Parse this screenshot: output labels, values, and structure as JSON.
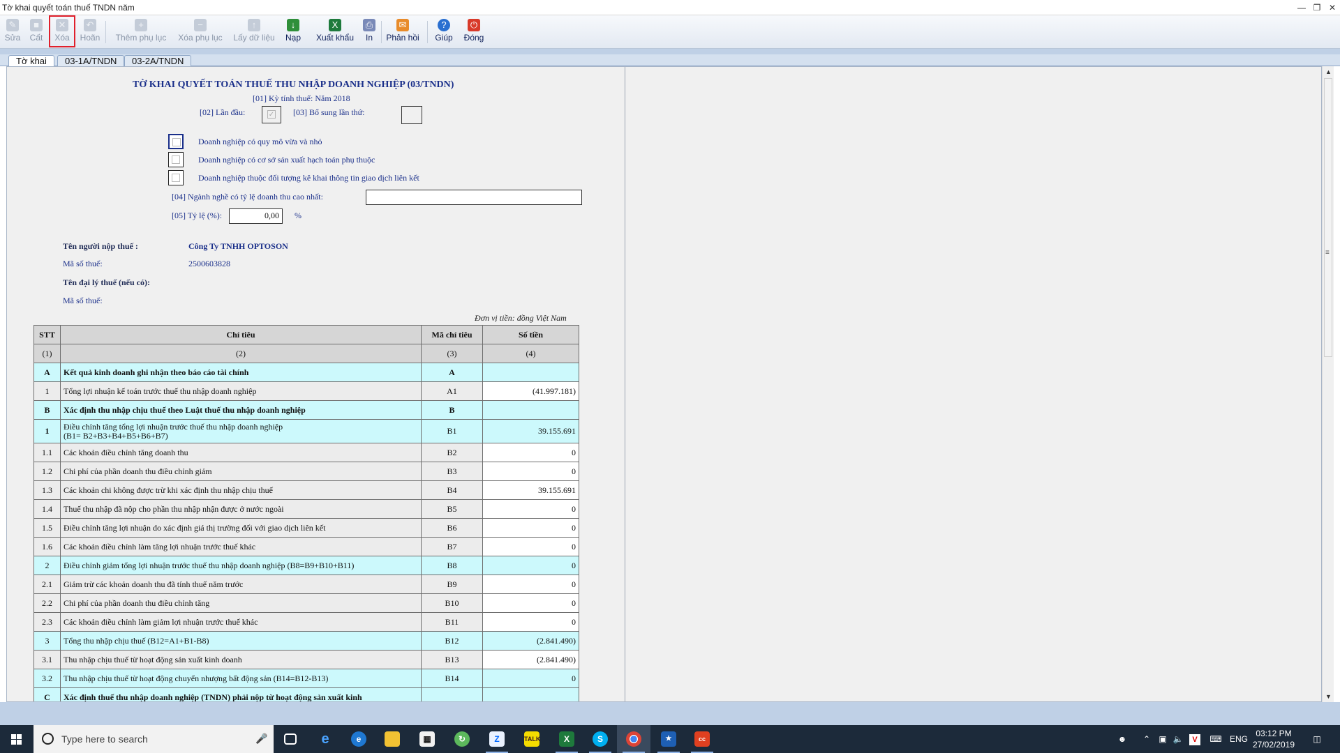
{
  "window": {
    "title": "Tờ khai quyết toán thuế TNDN năm"
  },
  "toolbar": {
    "sua": "Sửa",
    "cat": "Cất",
    "xoa": "Xóa",
    "hoan": "Hoãn",
    "them_phu_luc": "Thêm phụ lục",
    "xoa_phu_luc": "Xóa phụ lục",
    "lay_du_lieu": "Lấy dữ liệu",
    "nap": "Nạp",
    "xuat_khau": "Xuất khẩu",
    "in": "In",
    "phan_hoi": "Phản hồi",
    "giup": "Giúp",
    "dong": "Đóng"
  },
  "tabs": {
    "to_khai": "Tờ khai",
    "pl_1a": "03-1A/TNDN",
    "pl_2a": "03-2A/TNDN"
  },
  "form": {
    "title": "TỜ KHAI QUYẾT TOÁN THUẾ THU NHẬP DOANH NGHIỆP (03/TNDN)",
    "ky_tinh_thue": "[01] Kỳ tính thuế: Năm 2018",
    "lan_dau": "[02] Lần đầu:",
    "bo_sung": "[03] Bổ sung lần thứ:",
    "check_sme": "Doanh nghiệp có quy mô vừa và nhỏ",
    "check_phu_thuoc": "Doanh nghiệp có cơ sở sản xuất hạch toán phụ thuộc",
    "check_lien_ket": "Doanh nghiệp thuộc đối tượng kê khai thông tin giao dịch liên kết",
    "nganh_nghe": "[04] Ngành nghề có tỷ lệ doanh thu cao nhất:",
    "ty_le_label": "[05] Tỷ lệ (%):",
    "ty_le_value": "0,00",
    "percent": "%",
    "ten_nnt_label": "Tên người nộp thuế :",
    "ten_nnt": "Công Ty TNHH OPTOSON",
    "mst_label": "Mã số thuế:",
    "mst": "2500603828",
    "dai_ly_label": "Tên đại lý thuế (nếu có):",
    "mst_dl_label": "Mã số thuế:",
    "don_vi": "Đơn vị tiền: đồng Việt Nam"
  },
  "table": {
    "headers": {
      "stt": "STT",
      "chi_tieu": "Chỉ tiêu",
      "ma": "Mã chỉ tiêu",
      "so_tien": "Số tiền"
    },
    "subheaders": {
      "c1": "(1)",
      "c2": "(2)",
      "c3": "(3)",
      "c4": "(4)"
    },
    "rows": [
      {
        "stt": "A",
        "label": "Kết quả kinh doanh ghi nhận theo báo cáo tài chính",
        "code": "A",
        "value": ""
      },
      {
        "stt": "1",
        "label": "Tổng lợi nhuận kế toán trước thuế thu nhập doanh nghiệp",
        "code": "A1",
        "value": "(41.997.181)"
      },
      {
        "stt": "B",
        "label": "Xác định thu nhập chịu thuế theo Luật thuế thu nhập doanh nghiệp",
        "code": "B",
        "value": ""
      },
      {
        "stt": "1",
        "label": "Điều chỉnh tăng tổng lợi nhuận trước thuế thu nhập doanh nghiệp",
        "label2": "(B1= B2+B3+B4+B5+B6+B7)",
        "code": "B1",
        "value": "39.155.691"
      },
      {
        "stt": "1.1",
        "label": "Các khoản điều chỉnh tăng doanh thu",
        "code": "B2",
        "value": "0"
      },
      {
        "stt": "1.2",
        "label": "Chi phí của phần doanh thu điều chỉnh giảm",
        "code": "B3",
        "value": "0"
      },
      {
        "stt": "1.3",
        "label": "Các khoản chi không được trừ khi xác định thu nhập chịu thuế",
        "code": "B4",
        "value": "39.155.691"
      },
      {
        "stt": "1.4",
        "label": "Thuế thu nhập đã nộp cho phần thu nhập nhận được ở nước ngoài",
        "code": "B5",
        "value": "0"
      },
      {
        "stt": "1.5",
        "label": "Điều chỉnh tăng lợi nhuận do xác định giá thị trường đối với giao dịch liên kết",
        "code": "B6",
        "value": "0"
      },
      {
        "stt": "1.6",
        "label": "Các khoản điều chỉnh làm tăng lợi nhuận trước thuế khác",
        "code": "B7",
        "value": "0"
      },
      {
        "stt": "2",
        "label": "Điều chỉnh giảm tổng lợi nhuận trước thuế thu nhập doanh nghiệp (B8=B9+B10+B11)",
        "code": "B8",
        "value": "0"
      },
      {
        "stt": "2.1",
        "label": "Giảm trừ các khoản doanh thu đã tính thuế năm trước",
        "code": "B9",
        "value": "0"
      },
      {
        "stt": "2.2",
        "label": "Chi phí của phần doanh thu điều chỉnh tăng",
        "code": "B10",
        "value": "0"
      },
      {
        "stt": "2.3",
        "label": "Các khoản điều chỉnh làm giảm lợi nhuận trước thuế khác",
        "code": "B11",
        "value": "0"
      },
      {
        "stt": "3",
        "label": "Tổng thu nhập chịu thuế (B12=A1+B1-B8)",
        "code": "B12",
        "value": "(2.841.490)"
      },
      {
        "stt": "3.1",
        "label": "Thu nhập chịu thuế từ hoạt động sản xuất kinh doanh",
        "code": "B13",
        "value": "(2.841.490)"
      },
      {
        "stt": "3.2",
        "label": "Thu nhập chịu thuế từ hoạt động chuyển nhượng bất động sản (B14=B12-B13)",
        "code": "B14",
        "value": "0"
      },
      {
        "stt": "C",
        "label": "Xác định thuế thu nhập doanh nghiệp (TNDN) phải nộp từ hoạt động sản xuất kinh",
        "code": "",
        "value": ""
      }
    ]
  },
  "taskbar": {
    "search_placeholder": "Type here to search",
    "lang": "ENG",
    "time": "03:12 PM",
    "date": "27/02/2019"
  },
  "colors": {
    "title_blue": "#1a2f8a",
    "row_cyan": "#ccf9fc",
    "row_grey": "#ececec",
    "selected_outline": "#e0202c"
  }
}
